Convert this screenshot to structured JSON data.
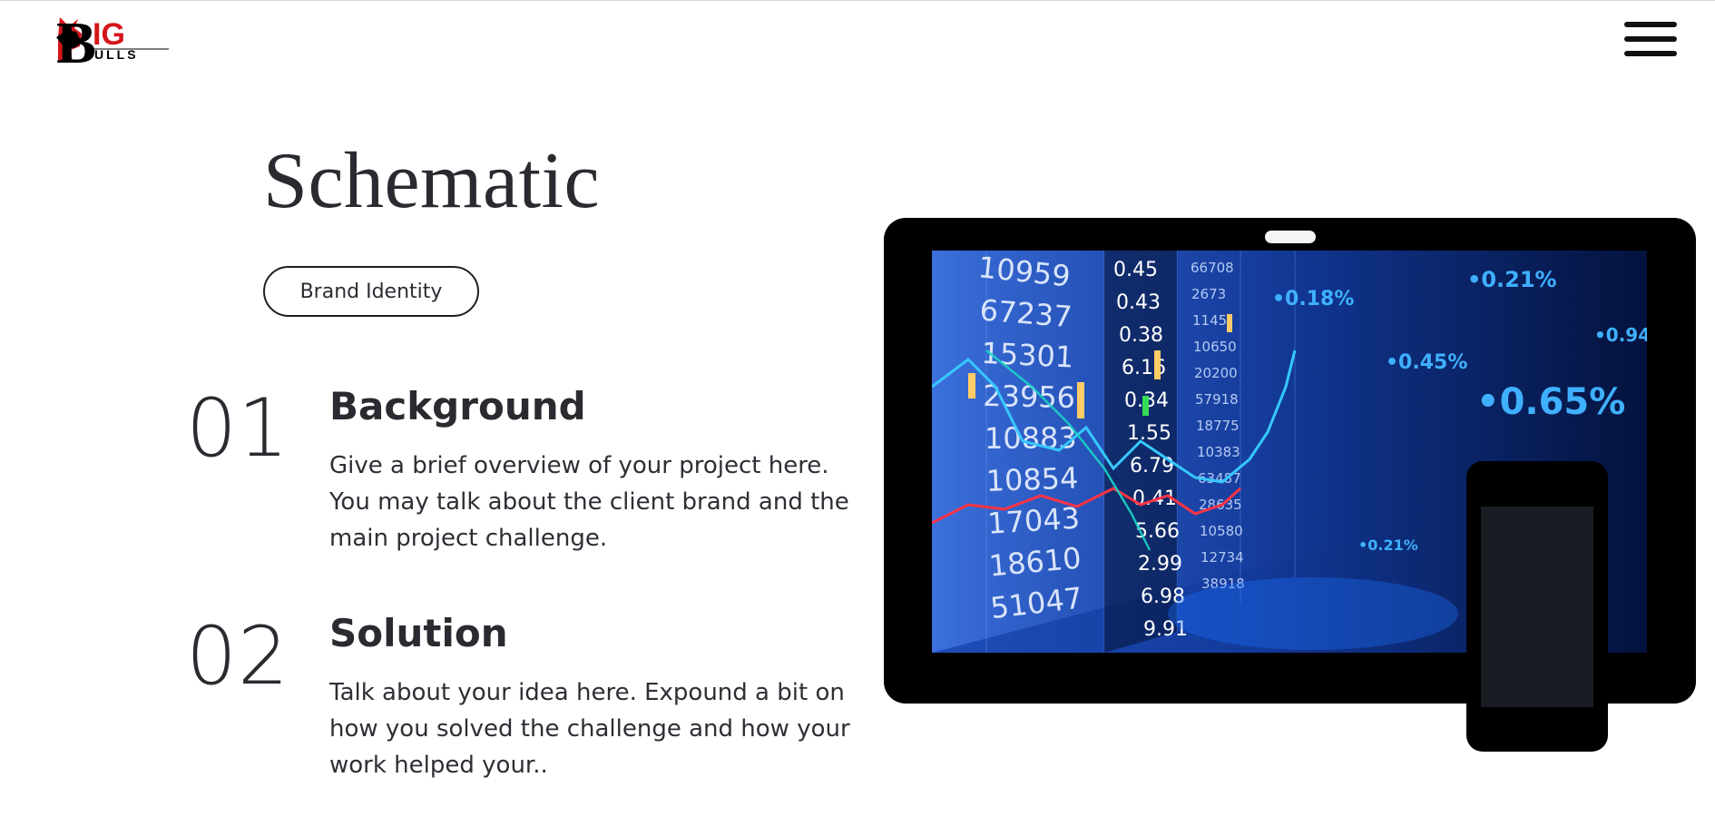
{
  "header": {
    "logo_text_top": "IG",
    "logo_text_bottom": "ULLS",
    "logo_letter": "B",
    "menu_icon": "hamburger-menu-icon"
  },
  "main": {
    "title": "Schematic",
    "tag": "Brand Identity",
    "sections": [
      {
        "number": "01",
        "heading": "Background",
        "body": "Give a brief overview of your project here. You may talk about the client brand and the main project challenge."
      },
      {
        "number": "02",
        "heading": "Solution",
        "body": "Talk about your idea here. Expound a bit on how you solved the challenge and how your work helped your.."
      }
    ]
  },
  "mockup": {
    "ticker_numbers": [
      "10959",
      "67237",
      "15301",
      "23956",
      "10883",
      "10854",
      "17043",
      "18610",
      "51047"
    ],
    "ticker_small": [
      "0.45",
      "0.43",
      "0.38",
      "6.16",
      "0.34",
      "1.55",
      "6.79",
      "0.41",
      "5.66",
      "2.99",
      "6.98",
      "9.91"
    ],
    "ticker_col3": [
      "66708",
      "2673",
      "1145",
      "10650",
      "20200",
      "57918",
      "18775",
      "10383",
      "63487",
      "28635",
      "10580",
      "12734",
      "38918"
    ],
    "percentages": [
      "0.18%",
      "0.21%",
      "0.45%",
      "0.65%",
      "0.94",
      "0.21%"
    ],
    "colors": {
      "screen_bg": "#0a1b4d",
      "accent": "#39a4ff"
    }
  }
}
